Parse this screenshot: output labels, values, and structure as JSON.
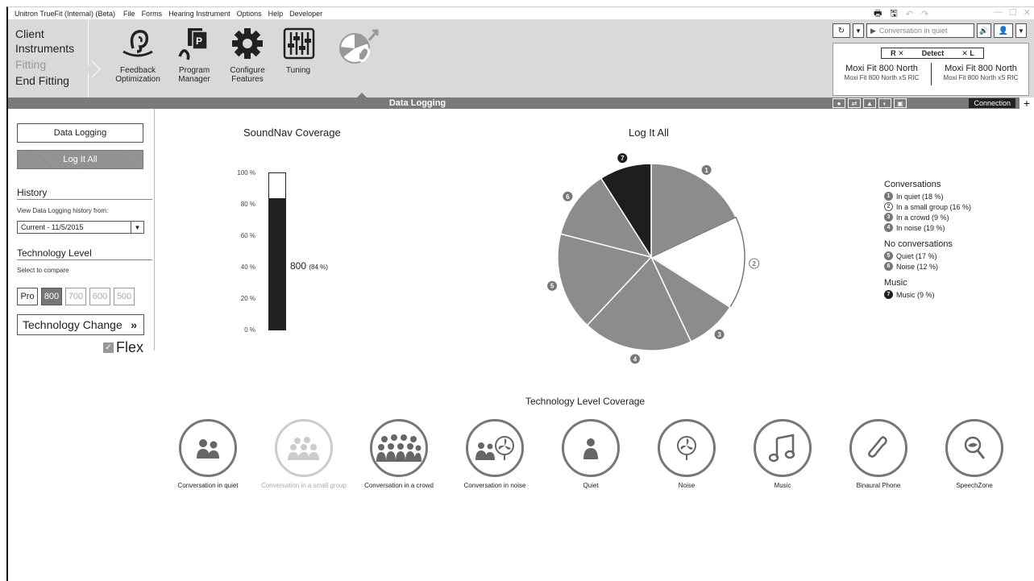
{
  "menubar": {
    "app_title": "Unitron TrueFit (Internal) (Beta)",
    "items": [
      "File",
      "Forms",
      "Hearing Instrument",
      "Options",
      "Help",
      "Developer"
    ]
  },
  "steps": {
    "client": "Client",
    "instruments": "Instruments",
    "fitting": "Fitting",
    "end_fitting": "End Fitting"
  },
  "tools": {
    "feedback": "Feedback Optimization",
    "program_manager": "Program Manager",
    "configure": "Configure Features",
    "tuning": "Tuning"
  },
  "strip_title": "Data Logging",
  "device": {
    "program_field": "Conversation in quiet",
    "head_r": "R ✕",
    "head_detect": "Detect",
    "head_l": "✕ L",
    "right_model": "Moxi Fit 800 North",
    "right_sub": "Moxi Fit 800 North xS RIC",
    "left_model": "Moxi Fit 800 North",
    "left_sub": "Moxi Fit 800 North xS RIC",
    "connection": "Connection"
  },
  "left": {
    "data_logging_btn": "Data Logging",
    "log_it_all_btn": "Log It All",
    "history": "History",
    "view_from": "View Data Logging history from:",
    "history_value": "Current - 11/5/2015",
    "tech_level": "Technology Level",
    "select_compare": "Select to compare",
    "levels": [
      "Pro",
      "800",
      "700",
      "600",
      "500"
    ],
    "tech_change": "Technology Change",
    "flex": "Flex"
  },
  "soundnav": {
    "title": "SoundNav Coverage",
    "ticks": [
      "100 %",
      "80 %",
      "60 %",
      "40 %",
      "20 %",
      "0 %"
    ],
    "value_label": "800",
    "value_pct": "(84 %)",
    "value": 84
  },
  "pie": {
    "title": "Log It All",
    "legend": {
      "conv_head": "Conversations",
      "conv_items": [
        "In quiet (18 %)",
        "In a small group (16 %)",
        "In a crowd (9 %)",
        "In noise (19 %)"
      ],
      "noconv_head": "No conversations",
      "noconv_items": [
        "Quiet (17 %)",
        "Noise (12 %)"
      ],
      "music_head": "Music",
      "music_items": [
        "Music (9 %)"
      ]
    }
  },
  "chart_data": {
    "type": "pie",
    "title": "Log It All",
    "categories": [
      "In quiet",
      "In a small group",
      "In a crowd",
      "In noise",
      "Quiet",
      "Noise",
      "Music"
    ],
    "values": [
      18,
      16,
      9,
      19,
      17,
      12,
      9
    ],
    "markers": [
      "1",
      "2",
      "3",
      "4",
      "5",
      "6",
      "7"
    ],
    "colors": [
      "#8c8c8c",
      "#ffffff",
      "#8c8c8c",
      "#8c8c8c",
      "#8c8c8c",
      "#8c8c8c",
      "#1e1e1e"
    ]
  },
  "coverage": {
    "title": "Technology Level Coverage",
    "items": [
      {
        "label": "Conversation in quiet"
      },
      {
        "label": "Conversation in a small group"
      },
      {
        "label": "Conversation in a crowd"
      },
      {
        "label": "Conversation in noise"
      },
      {
        "label": "Quiet"
      },
      {
        "label": "Noise"
      },
      {
        "label": "Music"
      },
      {
        "label": "Binaural Phone"
      },
      {
        "label": "SpeechZone"
      }
    ]
  }
}
